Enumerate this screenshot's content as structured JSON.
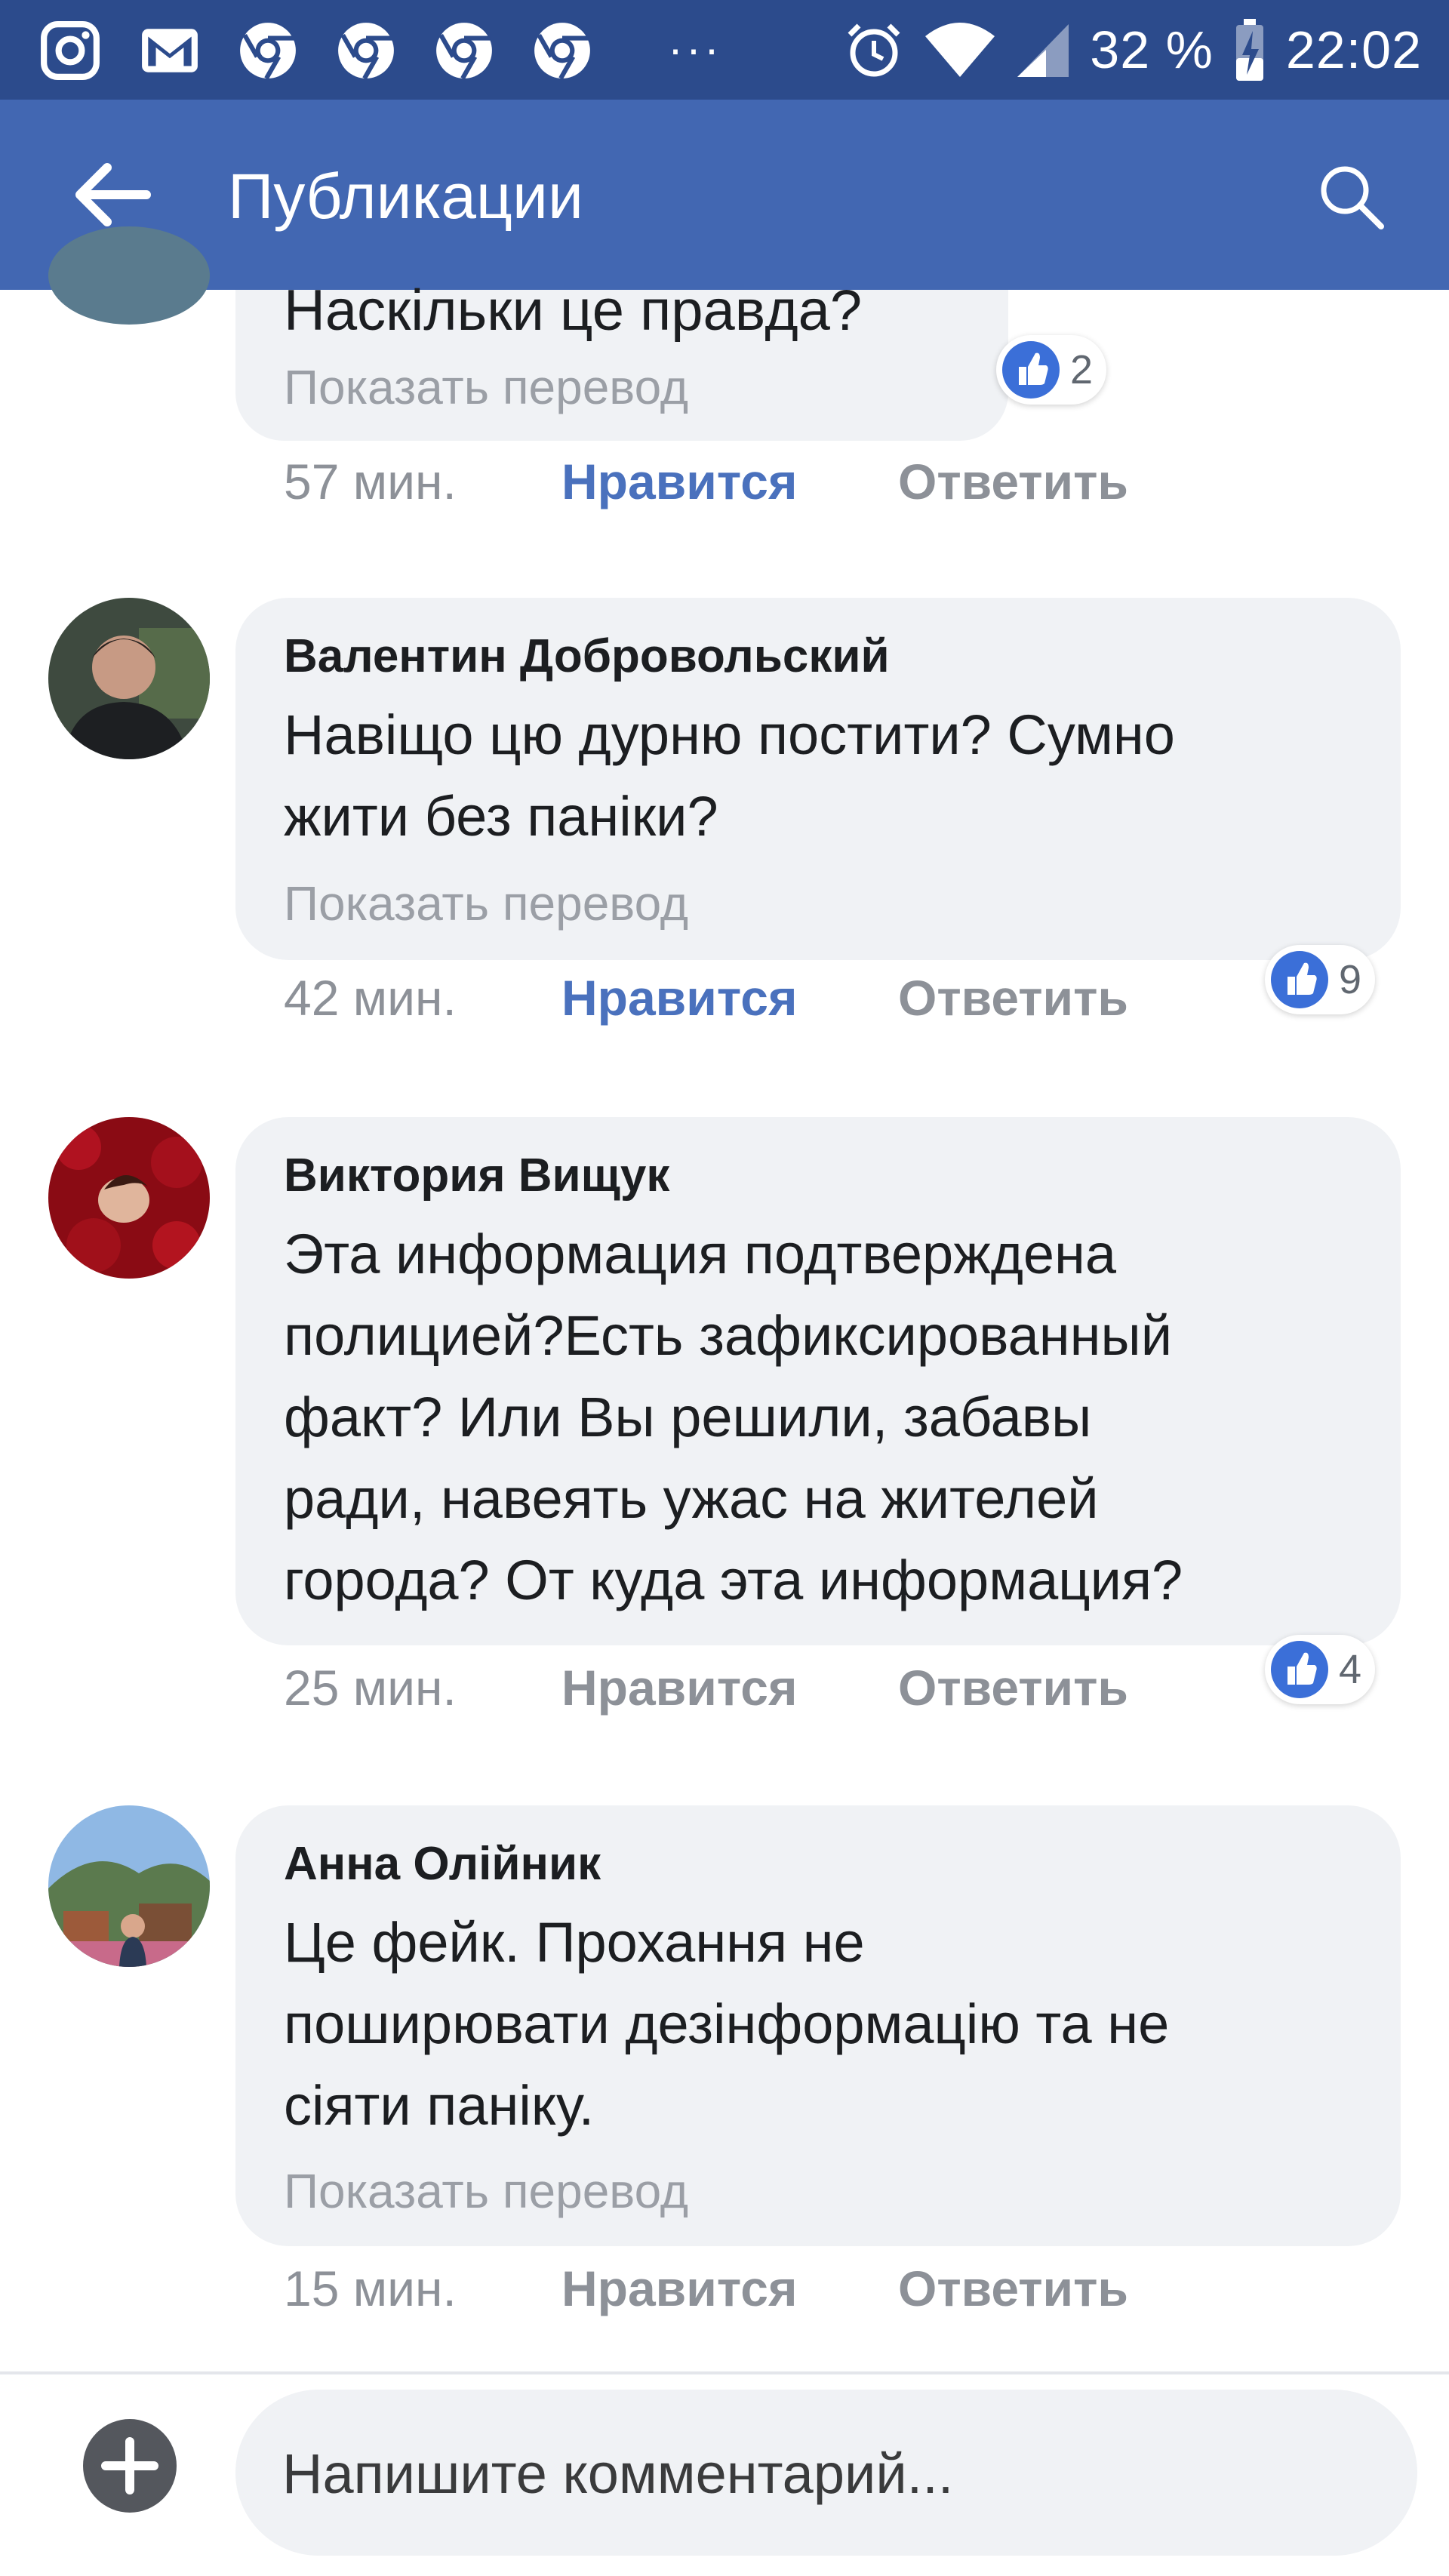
{
  "status_bar": {
    "battery": "32 %",
    "time": "22:02",
    "more": "···"
  },
  "app_bar": {
    "title": "Публикации"
  },
  "comments": [
    {
      "text": "Наскільки це правда?",
      "translate": "Показать перевод",
      "time": "57 мин.",
      "like": "Нравится",
      "reply": "Ответить",
      "reactions": "2"
    },
    {
      "author": "Валентин Добровольский",
      "text_lines": [
        "Навіщо цю дурню постити? Сумно",
        "жити без паніки?"
      ],
      "translate": "Показать перевод",
      "time": "42 мин.",
      "like": "Нравится",
      "reply": "Ответить",
      "reactions": "9"
    },
    {
      "author": "Виктория Вищук",
      "text_lines": [
        "Эта информация подтверждена",
        "полицией?Есть зафиксированный",
        "факт? Или Вы решили, забавы",
        "ради, навеять ужас на жителей",
        "города? От куда эта информация?"
      ],
      "time": "25 мин.",
      "like": "Нравится",
      "reply": "Ответить",
      "reactions": "4"
    },
    {
      "author": "Анна Олійник",
      "text_lines": [
        "Це фейк.  Прохання не",
        "поширювати дезінформацію та не",
        "сіяти паніку."
      ],
      "translate": "Показать перевод",
      "time": "15 мин.",
      "like": "Нравится",
      "reply": "Ответить"
    }
  ],
  "composer": {
    "placeholder": "Напишите комментарий..."
  },
  "colors": {
    "status_bar": "#2c4b8c",
    "app_bar": "#4267b2",
    "like_active": "#4a71bd",
    "bubble": "#f0f2f5"
  }
}
